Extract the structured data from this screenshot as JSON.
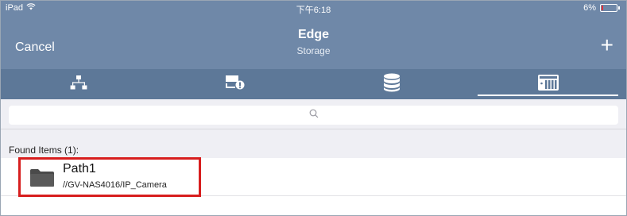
{
  "status_bar": {
    "carrier": "iPad",
    "time": "下午6:18",
    "battery": "6%"
  },
  "nav": {
    "cancel_label": "Cancel",
    "title": "Edge",
    "subtitle": "Storage",
    "add_label": "+"
  },
  "tabs": [
    {
      "icon": "network-tree-icon",
      "active": false
    },
    {
      "icon": "device-settings-icon",
      "active": false
    },
    {
      "icon": "database-icon",
      "active": false
    },
    {
      "icon": "nas-storage-icon",
      "active": true
    }
  ],
  "search": {
    "placeholder": ""
  },
  "section": {
    "header": "Found Items (1):"
  },
  "items": [
    {
      "icon": "folder-icon",
      "name": "Path1",
      "path": "//GV-NAS4016/IP_Camera"
    }
  ],
  "colors": {
    "bar": "#6f88a8",
    "tabbar": "#5d7898",
    "highlight": "#d71e1e"
  }
}
